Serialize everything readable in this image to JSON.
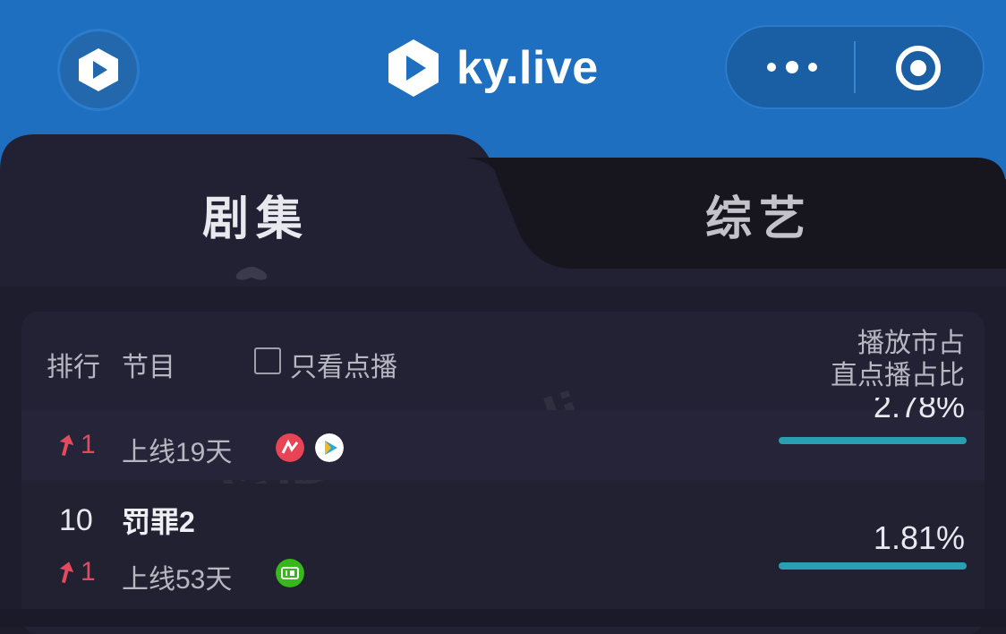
{
  "header": {
    "brand_name": "ky.live",
    "bg_color": "#1e6fc0",
    "left_icon": "ky-logo-icon",
    "menu_icon": "more-dots-icon",
    "close_icon": "target-circle-icon"
  },
  "tabs": [
    {
      "label": "剧集",
      "active": true
    },
    {
      "label": "综艺",
      "active": false
    }
  ],
  "table": {
    "col_rank": "排行",
    "col_program": "节目",
    "filter_label": "只看点播",
    "filter_checked": false,
    "col_right_line1": "播放市占",
    "col_right_line2": "直点播占比"
  },
  "rows": [
    {
      "rank_change": "1",
      "days": "上线19天",
      "percent": "2.78%",
      "platforms": [
        "mgtv-icon",
        "tencent-video-icon"
      ]
    },
    {
      "rank": "10",
      "title": "罚罪2",
      "rank_change": "1",
      "days": "上线53天",
      "percent": "1.81%",
      "platforms": [
        "iqiyi-icon"
      ]
    }
  ],
  "accent_colors": {
    "rank_up": "#e24a5e",
    "bar": "#2a9fb2"
  }
}
